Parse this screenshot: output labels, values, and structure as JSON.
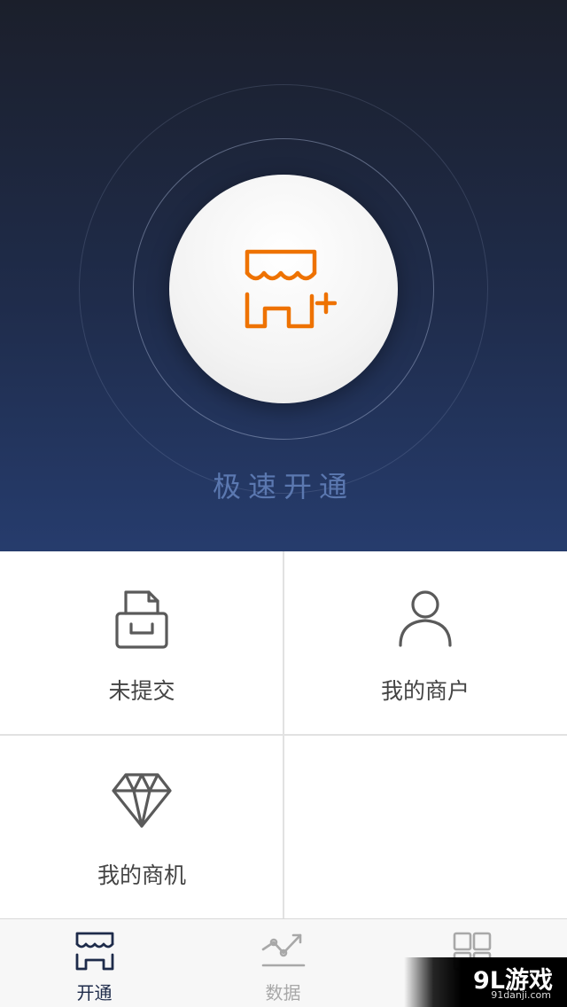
{
  "hero": {
    "title": "极速开通",
    "icon": "store-add-icon",
    "colors": {
      "accent": "#ee7200",
      "label": "#5b78b0"
    }
  },
  "grid": {
    "items": [
      {
        "label": "未提交",
        "icon": "drawer-file-icon"
      },
      {
        "label": "我的商户",
        "icon": "person-icon"
      },
      {
        "label": "我的商机",
        "icon": "diamond-icon"
      }
    ]
  },
  "tabbar": {
    "tabs": [
      {
        "label": "开通",
        "icon": "store-icon",
        "active": true
      },
      {
        "label": "数据",
        "icon": "trend-chart-icon",
        "active": false
      },
      {
        "label": "",
        "icon": "grid-apps-icon",
        "active": false
      }
    ]
  },
  "watermark": {
    "logo": "9L游戏",
    "url": "91danji.com"
  }
}
